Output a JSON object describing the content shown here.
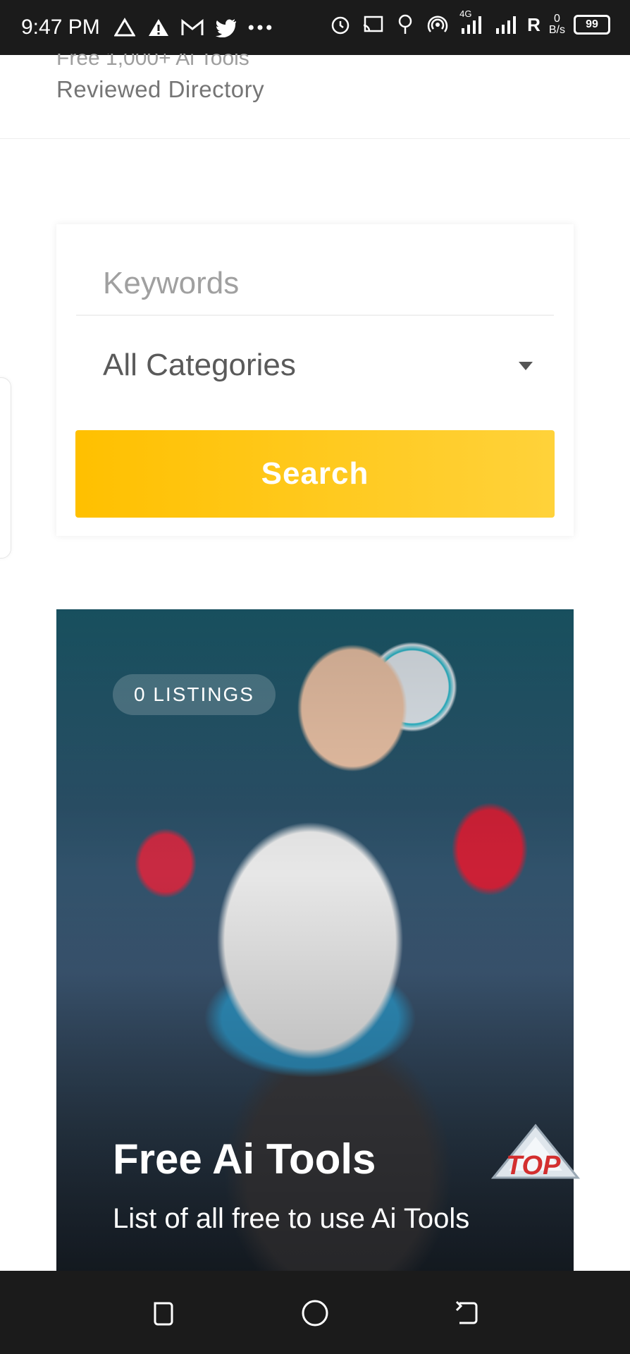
{
  "status_bar": {
    "time": "9:47 PM",
    "network_label": "4G",
    "roaming": "R",
    "speed_top": "0",
    "speed_bottom": "B/s",
    "battery": "99",
    "left_icons": [
      "warning-outline-icon",
      "warning-filled-icon",
      "gmail-icon",
      "twitter-icon",
      "more-dots-icon"
    ],
    "right_icons": [
      "alarm-icon",
      "cast-icon",
      "location-icon",
      "hotspot-icon",
      "signal-icon",
      "signal-icon-2"
    ]
  },
  "header": {
    "line1": "Free 1,000+ Ai Tools",
    "line2": "Reviewed Directory"
  },
  "search": {
    "keywords_placeholder": "Keywords",
    "category_selected": "All Categories",
    "button_label": "Search"
  },
  "listing": {
    "badge": "0 LISTINGS",
    "title": "Free Ai Tools",
    "subtitle": "List of all free to use Ai Tools"
  },
  "top_button": {
    "label": "TOP"
  },
  "navbar": {
    "icons": [
      "recent-apps-icon",
      "home-icon",
      "back-icon"
    ]
  },
  "colors": {
    "accent": "#ffc107",
    "status_bar": "#1b1b1b"
  }
}
